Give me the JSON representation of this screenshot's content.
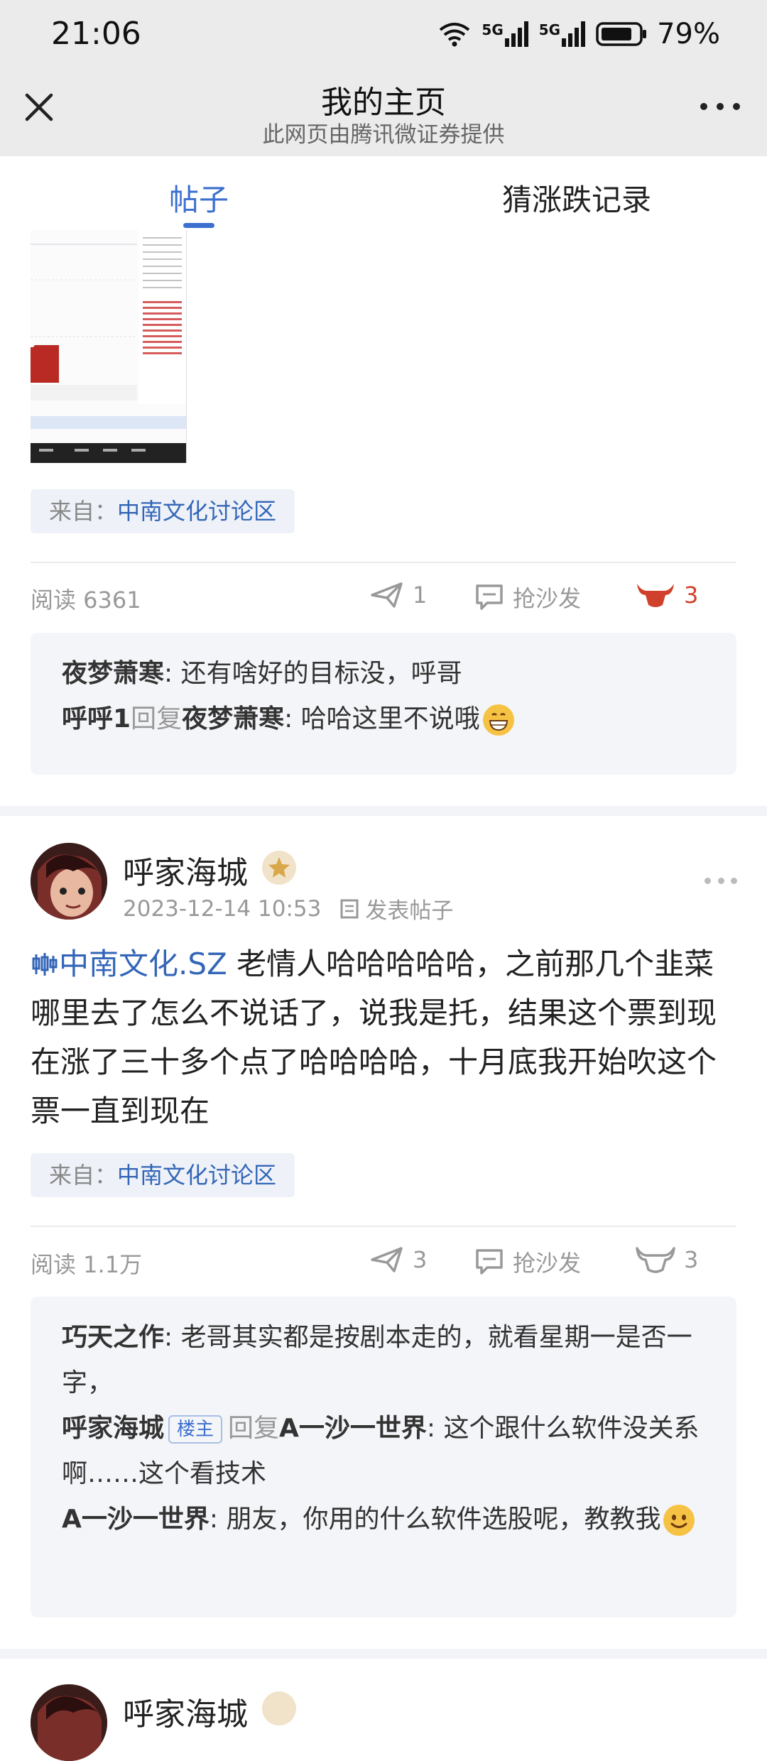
{
  "status_bar": {
    "time": "21:06",
    "battery": "79%",
    "network_1": "5G",
    "network_2": "5G"
  },
  "header": {
    "title": "我的主页",
    "subtitle": "此网页由腾讯微证券提供"
  },
  "tabs": [
    {
      "label": "帖子",
      "active": true
    },
    {
      "label": "猜涨跌记录",
      "active": false
    }
  ],
  "post1": {
    "tag_from": "来自：",
    "tag_board": "中南文化讨论区",
    "reads": "阅读 6361",
    "shares": "1",
    "comment_label": "抢沙发",
    "likes": "3",
    "comments": [
      {
        "user": "夜梦萧寒",
        "text": ": 还有啥好的目标没，呼哥"
      },
      {
        "user": "呼呼1",
        "reply_word": "回复",
        "reply_to": "夜梦萧寒",
        "text": ": 哈哈这里不说哦",
        "emoji": "grin-emoji"
      }
    ]
  },
  "post2": {
    "author": "呼家海城",
    "datetime": "2023-12-14 10:53",
    "post_type": "发表帖子",
    "stock_link": "中南文化.SZ",
    "body": " 老情人哈哈哈哈哈，之前那几个韭菜哪里去了怎么不说话了，说我是托，结果这个票到现在涨了三十多个点了哈哈哈哈，十月底我开始吹这个票一直到现在",
    "tag_from": "来自：",
    "tag_board": "中南文化讨论区",
    "reads": "阅读 1.1万",
    "shares": "3",
    "comment_label": "抢沙发",
    "likes": "3",
    "comments": [
      {
        "user": "巧天之作",
        "text": ": 老哥其实都是按剧本走的，就看星期一是否一字，"
      },
      {
        "user": "呼家海城",
        "badge": "楼主",
        "reply_word": "回复",
        "reply_to": "A一沙一世界",
        "text": ": 这个跟什么软件没关系啊……这个看技术"
      },
      {
        "user": "A一沙一世界",
        "text": ": 朋友，你用的什么软件选股呢，教教我",
        "emoji": "smile-emoji"
      }
    ]
  },
  "post3": {
    "author": "呼家海城"
  },
  "colors": {
    "accent": "#3b6fd0",
    "link": "#3466b7",
    "like_red": "#d0402b",
    "header_bg": "#ebebeb"
  }
}
